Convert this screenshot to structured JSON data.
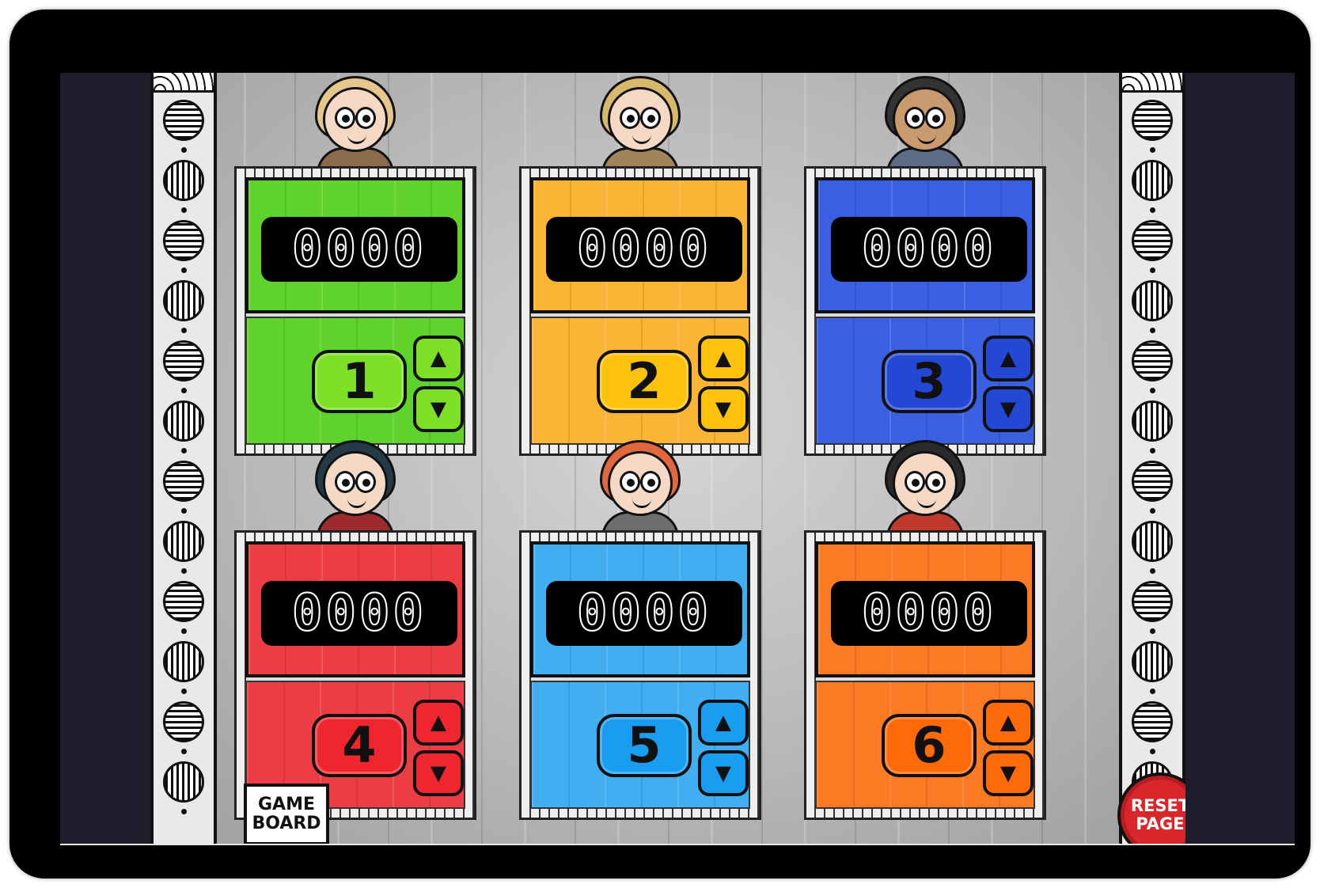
{
  "screen": {
    "background": "#1e1d2b"
  },
  "stations": [
    {
      "number": "1",
      "score": "0000",
      "color": "#5fd22b",
      "badge_color": "#7de026",
      "hair": "#e5c68b",
      "skin": "#f5d9c4",
      "shirt": "#8a6b4c"
    },
    {
      "number": "2",
      "score": "0000",
      "color": "#fbb534",
      "badge_color": "#fdc20c",
      "hair": "#d8b86a",
      "skin": "#f5d9c4",
      "shirt": "#a2845c"
    },
    {
      "number": "3",
      "score": "0000",
      "color": "#3a5fe0",
      "badge_color": "#2448d6",
      "hair": "#333333",
      "skin": "#c89a6e",
      "shirt": "#5c6c86"
    },
    {
      "number": "4",
      "score": "0000",
      "color": "#ec3d44",
      "badge_color": "#f0262f",
      "hair": "#243a47",
      "skin": "#f5d9c4",
      "shirt": "#9e2b2b"
    },
    {
      "number": "5",
      "score": "0000",
      "color": "#42aef2",
      "badge_color": "#199df0",
      "hair": "#e0673e",
      "skin": "#f5d9c4",
      "shirt": "#6e6e6e"
    },
    {
      "number": "6",
      "score": "0000",
      "color": "#fb7a24",
      "badge_color": "#ff6a08",
      "hair": "#2a2a2a",
      "skin": "#f5d9c4",
      "shirt": "#c0392b"
    }
  ],
  "buttons": {
    "up_icon": "▲",
    "down_icon": "▼",
    "game_board_line1": "GAME",
    "game_board_line2": "BOARD",
    "reset_line1": "RESET",
    "reset_line2": "PAGE"
  }
}
